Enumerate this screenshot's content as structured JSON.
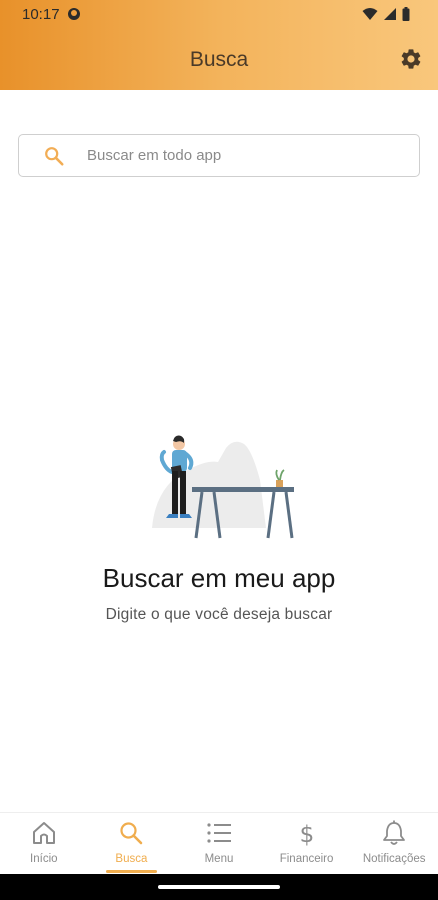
{
  "status_bar": {
    "time": "10:17"
  },
  "header": {
    "title": "Busca",
    "accent_start": "#e8912a",
    "accent_end": "#f9c77c"
  },
  "search": {
    "placeholder": "Buscar em todo app",
    "value": ""
  },
  "empty_state": {
    "title": "Buscar em meu app",
    "subtitle": "Digite o que você deseja buscar"
  },
  "tabs": [
    {
      "label": "Início",
      "icon": "home-icon"
    },
    {
      "label": "Busca",
      "icon": "search-icon",
      "active": true
    },
    {
      "label": "Menu",
      "icon": "list-icon"
    },
    {
      "label": "Financeiro",
      "icon": "dollar-icon"
    },
    {
      "label": "Notificações",
      "icon": "bell-icon"
    }
  ],
  "colors": {
    "active_tab": "#f0ad4e",
    "inactive_tab": "#8c8c8c"
  }
}
